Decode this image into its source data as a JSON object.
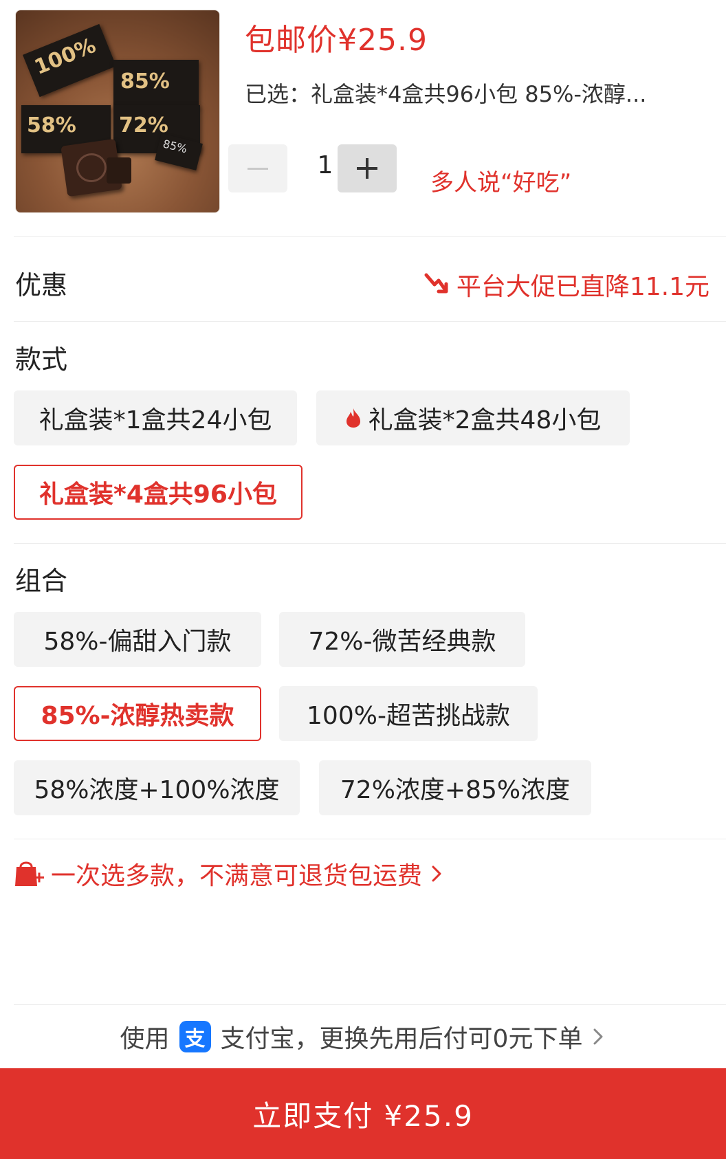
{
  "product": {
    "price_label": "包邮价¥25.9",
    "selected_text": "已选：礼盒装*4盒共96小包 85%-浓醇...",
    "image_text": {
      "c100": "100%",
      "c85": "85%",
      "c58": "58%",
      "c72": "72%",
      "c85b": "85%"
    },
    "quantity": "1",
    "praise": "多人说“好吃”"
  },
  "discount": {
    "label": "优惠",
    "value": "平台大促已直降11.1元"
  },
  "style_section": {
    "label": "款式",
    "options": [
      {
        "label": "礼盒装*1盒共24小包",
        "selected": false
      },
      {
        "label": "礼盒装*2盒共48小包",
        "selected": false,
        "hot": true
      },
      {
        "label": "礼盒装*4盒共96小包",
        "selected": true
      }
    ]
  },
  "combo_section": {
    "label": "组合",
    "options": [
      {
        "label": "58%-偏甜入门款",
        "selected": false
      },
      {
        "label": "72%-微苦经典款",
        "selected": false
      },
      {
        "label": "85%-浓醇热卖款",
        "selected": true
      },
      {
        "label": "100%-超苦挑战款",
        "selected": false
      },
      {
        "label": "58%浓度+100%浓度",
        "selected": false
      },
      {
        "label": "72%浓度+85%浓度",
        "selected": false
      }
    ]
  },
  "promo": {
    "text": "一次选多款，不满意可退货包运费"
  },
  "payment": {
    "prefix": "使用",
    "logo_char": "支",
    "text": "支付宝，更换先用后付可0元下单",
    "button": "立即支付 ¥25.9"
  },
  "colors": {
    "accent": "#e0322c",
    "chip_bg": "#f3f3f3",
    "alipay_blue": "#1677ff"
  }
}
